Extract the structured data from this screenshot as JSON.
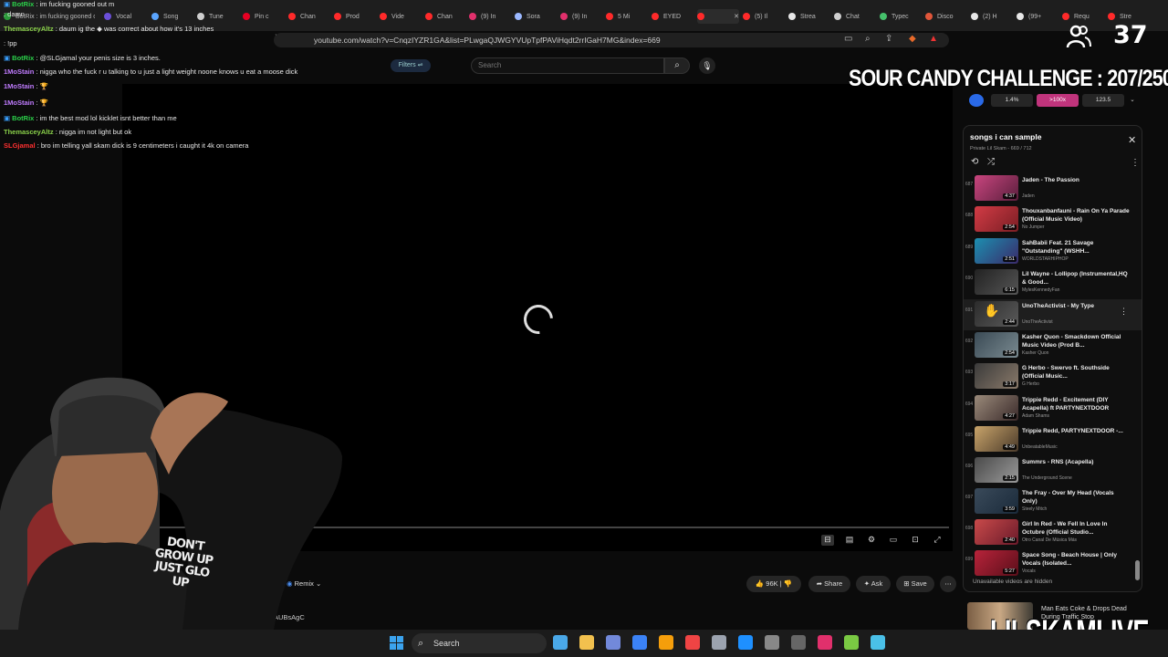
{
  "browser": {
    "tabs": [
      {
        "label": "BotRix : im fucking gooned out m",
        "color": "#2b9b3a"
      },
      {
        "label": "Vocal",
        "color": "#6b4fd8"
      },
      {
        "label": "Song",
        "color": "#5aa5ff"
      },
      {
        "label": "Tune",
        "color": "#cfcfcf"
      },
      {
        "label": "Pin c",
        "color": "#e60023"
      },
      {
        "label": "Chan",
        "color": "#ff2a2a"
      },
      {
        "label": "Prod",
        "color": "#ff2a2a"
      },
      {
        "label": "Vide",
        "color": "#ff2a2a"
      },
      {
        "label": "Chan",
        "color": "#ff2a2a"
      },
      {
        "label": "(9) In",
        "color": "#e1306c"
      },
      {
        "label": "Sora",
        "color": "#9bb8ff"
      },
      {
        "label": "(9) In",
        "color": "#e1306c"
      },
      {
        "label": "5 Mi",
        "color": "#ff2a2a"
      },
      {
        "label": "EYED",
        "color": "#ff2a2a"
      },
      {
        "label": "",
        "color": "#ff2a2a"
      },
      {
        "label": "(5) Il",
        "color": "#ff2a2a"
      },
      {
        "label": "Strea",
        "color": "#e8e8e8"
      },
      {
        "label": "Chat",
        "color": "#cfcfcf"
      },
      {
        "label": "Typec",
        "color": "#45c06b"
      },
      {
        "label": "Disco",
        "color": "#e0563a"
      },
      {
        "label": "(2) H",
        "color": "#e8e8e8"
      },
      {
        "label": "(99+",
        "color": "#e8e8e8"
      },
      {
        "label": "Requ",
        "color": "#ff2a2a"
      },
      {
        "label": "Stre",
        "color": "#ff2a2a"
      }
    ],
    "url": "youtube.com/watch?v=CnqzIYZR1GA&list=PLwgaQJWGYVUpTpfPAViHqdt2rrIGaH7MG&index=669"
  },
  "youtube": {
    "filters_label": "Filters",
    "search_placeholder": "Search",
    "actions": {
      "remix": "Remix",
      "likes": "96K",
      "share": "Share",
      "ask": "Ask",
      "save": "Save"
    },
    "description_snippet": "AUBsAgC"
  },
  "chat": [
    {
      "user": "BotRix",
      "text": ": im fucking gooned out m",
      "color": "#2bd14a",
      "bot": true
    },
    {
      "user": "",
      "text": ": damn",
      "color": "#ff3030",
      "bot": false
    },
    {
      "user": "ThemasceyAltz",
      "text": ": daum ig the",
      "color": "#8ad04a",
      "bot": false,
      "extra": "was correct about how it's 13 inches"
    },
    {
      "user": "",
      "text": ": !pp",
      "color": "#ff3030",
      "bot": false
    },
    {
      "user": "BotRix",
      "text": ": @SLGjamal your penis size is 3 inches.",
      "color": "#2bd14a",
      "bot": true
    },
    {
      "user": "1MoStain",
      "text": ": nigga who the fuck r u talking to u just a light weight noone knows u eat a moose dick",
      "color": "#c07cff",
      "bot": false
    },
    {
      "user": "1MoStain",
      "text": ":",
      "color": "#c07cff",
      "bot": false
    },
    {
      "user": "1MoStain",
      "text": ":",
      "color": "#c07cff",
      "bot": false
    },
    {
      "user": "BotRix",
      "text": ": im the best mod lol kicklet isnt better than me",
      "color": "#2bd14a",
      "bot": true
    },
    {
      "user": "ThemasceyAltz",
      "text": ": nigga im not light but ok",
      "color": "#8ad04a",
      "bot": false
    },
    {
      "user": "SLGjamal",
      "text": ": bro im telling yall skam dick is 9 centimeters i caught it 4k on camera",
      "color": "#ff3030",
      "bot": false
    }
  ],
  "overlay": {
    "viewer_count": "37",
    "challenge": "SOUR CANDY CHALLENGE : 207/250",
    "brand": "LILSKAMLIVE",
    "ext_buttons": [
      "1.4%",
      ">100x",
      "123.5"
    ]
  },
  "playlist": {
    "title": "songs i can sample",
    "subtitle": "Private  Lil Skam - 669 / 712",
    "hidden_note": "Unavailable videos are hidden",
    "items": [
      {
        "index": "687",
        "title": "Jaden - The Passion",
        "channel": "Jaden",
        "duration": "4:37",
        "thumb": [
          "#c9457e",
          "#5a1f3d"
        ]
      },
      {
        "index": "688",
        "title": "Thouxanbanfauni - Rain On Ya Parade (Official Music Video)",
        "channel": "No Jumper",
        "duration": "2:54",
        "thumb": [
          "#d23b45",
          "#7a1e24"
        ]
      },
      {
        "index": "689",
        "title": "SahBabii Feat. 21 Savage \"Outstanding\" (WSHH...",
        "channel": "WORLDSTARHIPHOP",
        "duration": "2:51",
        "thumb": [
          "#1c8fb0",
          "#3a2a6a"
        ]
      },
      {
        "index": "690",
        "title": "Lil Wayne - Lollipop (Instrumental,HQ & Good...",
        "channel": "MylesKennedyFan",
        "duration": "6:15",
        "thumb": [
          "#222",
          "#555"
        ]
      },
      {
        "index": "691",
        "title": "UnoTheActivist - My Type",
        "channel": "UnoTheActivist",
        "duration": "2:44",
        "thumb": [
          "#2b2b2b",
          "#5a5a5a"
        ],
        "active": true
      },
      {
        "index": "692",
        "title": "Kasher Quon - Smackdown Official Music Video (Prod B...",
        "channel": "Kasher Quon",
        "duration": "2:54",
        "thumb": [
          "#3a4a55",
          "#7a8a90"
        ]
      },
      {
        "index": "693",
        "title": "G Herbo - Swervo ft. Southside (Official Music...",
        "channel": "G Herbo",
        "duration": "3:17",
        "thumb": [
          "#3a3a3a",
          "#8a7a6a"
        ]
      },
      {
        "index": "694",
        "title": "Trippie Redd - Excitement (DIY Acapella) ft PARTYNEXTDOOR",
        "channel": "Adam Shams",
        "duration": "4:27",
        "thumb": [
          "#9a8a7a",
          "#3a2a2a"
        ]
      },
      {
        "index": "695",
        "title": "Trippie Redd, PARTYNEXTDOOR -...",
        "channel": "UnbeatableMusic",
        "duration": "4:49",
        "thumb": [
          "#c9a46a",
          "#4a3a2a"
        ]
      },
      {
        "index": "696",
        "title": "Summrs - RNS (Acapella)",
        "channel": "The Underground Scene",
        "duration": "2:15",
        "thumb": [
          "#4a4a4a",
          "#9a9a9a"
        ]
      },
      {
        "index": "697",
        "title": "The Fray - Over My Head (Vocals Only)",
        "channel": "Steely Mitch",
        "duration": "3:59",
        "thumb": [
          "#3a4a5a",
          "#1a2a3a"
        ]
      },
      {
        "index": "698",
        "title": "Girl In Red - We Fell In Love In Octubre (Official Studio...",
        "channel": "Otro Canal De Música Más",
        "duration": "2:40",
        "thumb": [
          "#c94a4a",
          "#6a1a2a"
        ]
      },
      {
        "index": "699",
        "title": "Space Song - Beach House | Only Vocals (Isolated...",
        "channel": "Vocals",
        "duration": "5:27",
        "thumb": [
          "#b8233a",
          "#5a0f1a"
        ]
      }
    ]
  },
  "promo": {
    "text": "Man Eats Coke & Drops Dead During Traffic Stop"
  },
  "taskbar": {
    "search_label": "Search",
    "apps": [
      "#4aa8e8",
      "#f2c14e",
      "#7289da",
      "#3b82f6",
      "#f59e0b",
      "#ef4444",
      "#9ca3af",
      "#1e90ff",
      "#888",
      "#666",
      "#e1306c",
      "#7ac943",
      "#4ac0e8"
    ]
  }
}
